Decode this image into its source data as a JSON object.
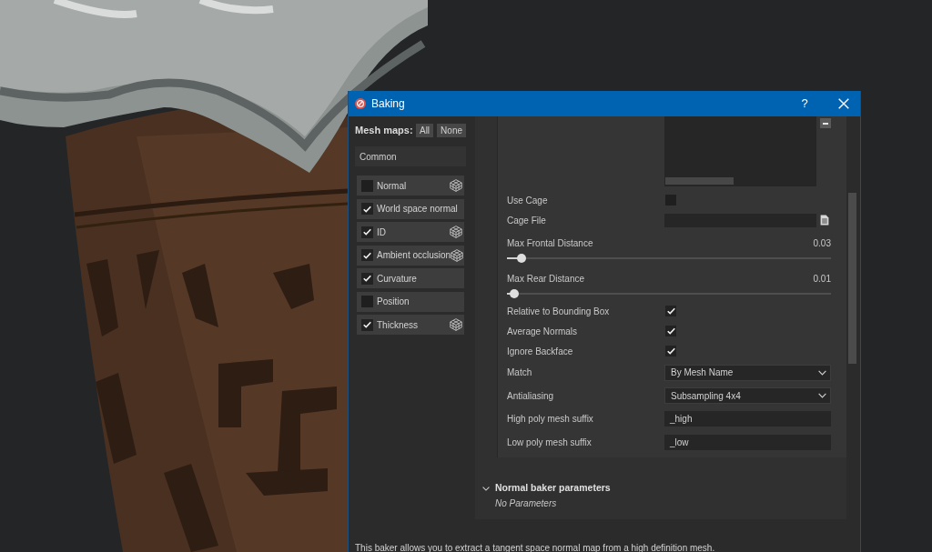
{
  "window": {
    "title": "Baking",
    "help_button": "?"
  },
  "mesh_maps": {
    "label": "Mesh maps:",
    "buttons": [
      "All",
      "None"
    ],
    "group": "Common",
    "items": [
      {
        "label": "Normal",
        "checked": false,
        "has_options": true
      },
      {
        "label": "World space normal",
        "checked": true,
        "has_options": false
      },
      {
        "label": "ID",
        "checked": true,
        "has_options": true
      },
      {
        "label": "Ambient occlusion",
        "checked": true,
        "has_options": true
      },
      {
        "label": "Curvature",
        "checked": true,
        "has_options": false
      },
      {
        "label": "Position",
        "checked": false,
        "has_options": false
      },
      {
        "label": "Thickness",
        "checked": true,
        "has_options": true
      }
    ]
  },
  "parameters": [
    {
      "kind": "checkbox",
      "label": "Use Cage",
      "checked": false
    },
    {
      "kind": "file",
      "label": "Cage File"
    },
    {
      "kind": "slider",
      "label": "Max Frontal Distance",
      "reading": "0.03",
      "level": 0.045
    },
    {
      "kind": "slider",
      "label": "Max Rear Distance",
      "reading": "0.01",
      "level": 0.022
    },
    {
      "kind": "checkbox",
      "label": "Relative to Bounding Box",
      "checked": true
    },
    {
      "kind": "checkbox",
      "label": "Average Normals",
      "checked": true
    },
    {
      "kind": "checkbox",
      "label": "Ignore Backface",
      "checked": true
    },
    {
      "kind": "dropdown",
      "label": "Match",
      "value": "By Mesh Name"
    },
    {
      "kind": "dropdown",
      "label": "Antialiasing",
      "value": "Subsampling 4x4"
    },
    {
      "kind": "text",
      "label": "High poly mesh suffix",
      "value": "_high"
    },
    {
      "kind": "text",
      "label": "Low poly mesh suffix",
      "value": "_low"
    }
  ],
  "section": {
    "title": "Normal baker parameters",
    "expanded": true,
    "note": "No Parameters"
  },
  "description": "This baker allows you to extract a tangent space normal map from a high definition mesh."
}
